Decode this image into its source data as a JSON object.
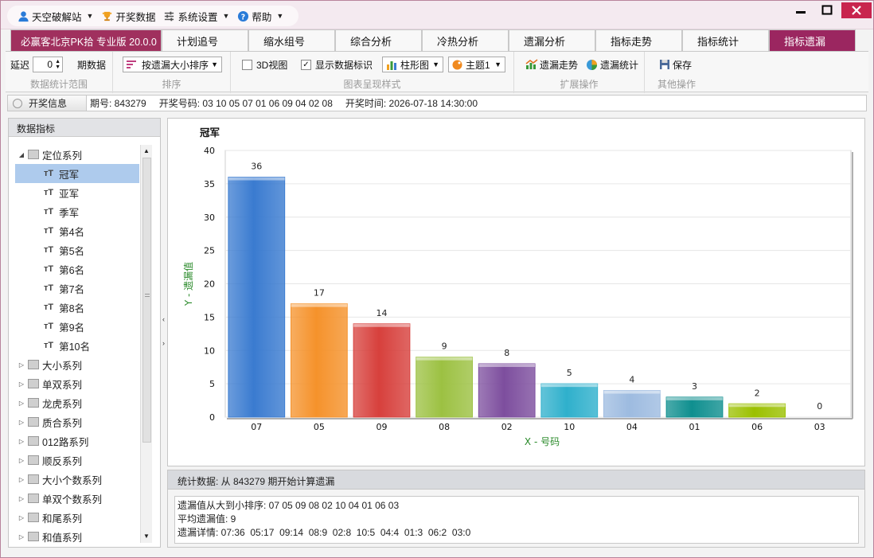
{
  "menu": {
    "items": [
      {
        "label": "天空破解站",
        "icon": "user-icon",
        "dropdown": true
      },
      {
        "label": "开奖数据",
        "icon": "trophy-icon",
        "dropdown": false
      },
      {
        "label": "系统设置",
        "icon": "settings-icon",
        "dropdown": true
      },
      {
        "label": "帮助",
        "icon": "help-icon",
        "dropdown": true
      }
    ]
  },
  "tabs": [
    {
      "label": "必赢客北京PK拾 专业版 20.0.0",
      "active": false,
      "brand": true
    },
    {
      "label": "计划追号"
    },
    {
      "label": "缩水组号"
    },
    {
      "label": "综合分析"
    },
    {
      "label": "冷热分析"
    },
    {
      "label": "遗漏分析"
    },
    {
      "label": "指标走势"
    },
    {
      "label": "指标统计"
    },
    {
      "label": "指标遗漏",
      "active": true
    }
  ],
  "toolbar": {
    "delay_label": "延迟",
    "delay_value": "0",
    "delay_unit": "期数据",
    "group1_label": "数据统计范围",
    "sort_value": "按遗漏大小排序",
    "group2_label": "排序",
    "view3d_label": "3D视图",
    "view3d_checked": false,
    "show_labels_label": "显示数据标识",
    "show_labels_checked": true,
    "chart_type_value": "柱形图",
    "theme_value": "主题1",
    "group3_label": "图表呈现样式",
    "trend_label": "遗漏走势",
    "stats_label": "遗漏统计",
    "group4_label": "扩展操作",
    "save_label": "保存",
    "group5_label": "其他操作"
  },
  "draw": {
    "button_label": "开奖信息",
    "issue_text": "期号: 843279",
    "numbers_text": "开奖号码: 03 10 05 07 01 06 09 04 02 08",
    "time_text": "开奖时间: 2026-07-18 14:30:00"
  },
  "left": {
    "title": "数据指标",
    "tree": [
      {
        "label": "定位系列",
        "type": "group",
        "expanded": true
      },
      {
        "label": "冠军",
        "type": "child",
        "selected": true
      },
      {
        "label": "亚军",
        "type": "child"
      },
      {
        "label": "季军",
        "type": "child"
      },
      {
        "label": "第4名",
        "type": "child"
      },
      {
        "label": "第5名",
        "type": "child"
      },
      {
        "label": "第6名",
        "type": "child"
      },
      {
        "label": "第7名",
        "type": "child"
      },
      {
        "label": "第8名",
        "type": "child"
      },
      {
        "label": "第9名",
        "type": "child"
      },
      {
        "label": "第10名",
        "type": "child"
      },
      {
        "label": "大小系列",
        "type": "group"
      },
      {
        "label": "单双系列",
        "type": "group"
      },
      {
        "label": "龙虎系列",
        "type": "group"
      },
      {
        "label": "质合系列",
        "type": "group"
      },
      {
        "label": "012路系列",
        "type": "group"
      },
      {
        "label": "顺反系列",
        "type": "group"
      },
      {
        "label": "大小个数系列",
        "type": "group"
      },
      {
        "label": "单双个数系列",
        "type": "group"
      },
      {
        "label": "和尾系列",
        "type": "group"
      },
      {
        "label": "和值系列",
        "type": "group"
      }
    ]
  },
  "chart_data": {
    "type": "bar",
    "title": "冠军",
    "xlabel": "X - 号码",
    "ylabel": "Y - 遗漏值",
    "categories": [
      "07",
      "05",
      "09",
      "08",
      "02",
      "10",
      "04",
      "01",
      "06",
      "03"
    ],
    "values": [
      36,
      17,
      14,
      9,
      8,
      5,
      4,
      3,
      2,
      0
    ],
    "colors": [
      "#3a7bd0",
      "#f5922b",
      "#d7403c",
      "#9cc142",
      "#7d4e9e",
      "#2fb0cc",
      "#9dbbe0",
      "#0f8f8f",
      "#9bc000",
      "#bbbbbb"
    ],
    "ylim": [
      0,
      40
    ],
    "yticks": [
      0,
      5,
      10,
      15,
      20,
      25,
      30,
      35,
      40
    ],
    "grid": true,
    "data_labels": true
  },
  "stats": {
    "title": "统计数据: 从 843279 期开始计算遗漏",
    "line1": "遗漏值从大到小排序: 07 05 09 08 02 10 04 01 06 03",
    "line2": "平均遗漏值: 9",
    "line3": "遗漏详情: 07:36  05:17  09:14  08:9  02:8  10:5  04:4  01:3  06:2  03:0"
  }
}
